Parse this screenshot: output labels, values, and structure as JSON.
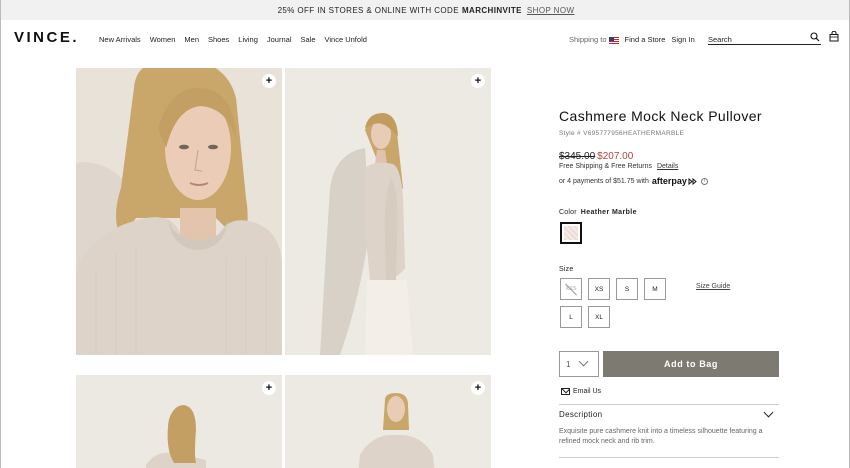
{
  "promo": {
    "text": "25% OFF IN STORES & ONLINE WITH CODE",
    "code": "MARCHINVITE",
    "link": "SHOP NOW"
  },
  "header": {
    "logo": "VINCE.",
    "nav": [
      "New Arrivals",
      "Women",
      "Men",
      "Shoes",
      "Living",
      "Journal",
      "Sale",
      "Vince Unfold"
    ],
    "shipping_to": "Shipping to",
    "find_store": "Find a Store",
    "sign_in": "Sign In",
    "search_placeholder": "Search"
  },
  "product": {
    "title": "Cashmere Mock Neck Pullover",
    "style": "Style # V695777956HEATHERMARBLE",
    "price_original": "$345.00",
    "price_sale": "$207.00",
    "shipping": "Free Shipping & Free Returns",
    "shipping_link": "Details",
    "afterpay_text": "or 4 payments of $51.75 with",
    "afterpay_brand": "afterpay",
    "color_label": "Color",
    "color_value": "Heather Marble",
    "size_label": "Size",
    "sizes": [
      {
        "label": "XXS",
        "available": false
      },
      {
        "label": "XS",
        "available": true
      },
      {
        "label": "S",
        "available": true
      },
      {
        "label": "M",
        "available": true
      },
      {
        "label": "L",
        "available": true
      },
      {
        "label": "XL",
        "available": true
      }
    ],
    "size_guide": "Size Guide",
    "quantity": "1",
    "add_to_bag": "Add to Bag",
    "email_us": "Email Us",
    "description_heading": "Description",
    "description_text": "Exquisite pure cashmere knit into a timeless silhouette featuring a refined mock neck and rib trim."
  },
  "colors": {
    "sale_price": "#b0463a",
    "button_bg": "#7d7a72",
    "sweater": "#ddd3c8",
    "hair": "#c9a66a"
  },
  "icons": {
    "zoom": "plus-icon",
    "search": "search-icon",
    "bag": "bag-icon",
    "mail": "mail-icon",
    "chevron": "chevron-down-icon",
    "info": "info-icon",
    "flag": "us-flag-icon"
  }
}
